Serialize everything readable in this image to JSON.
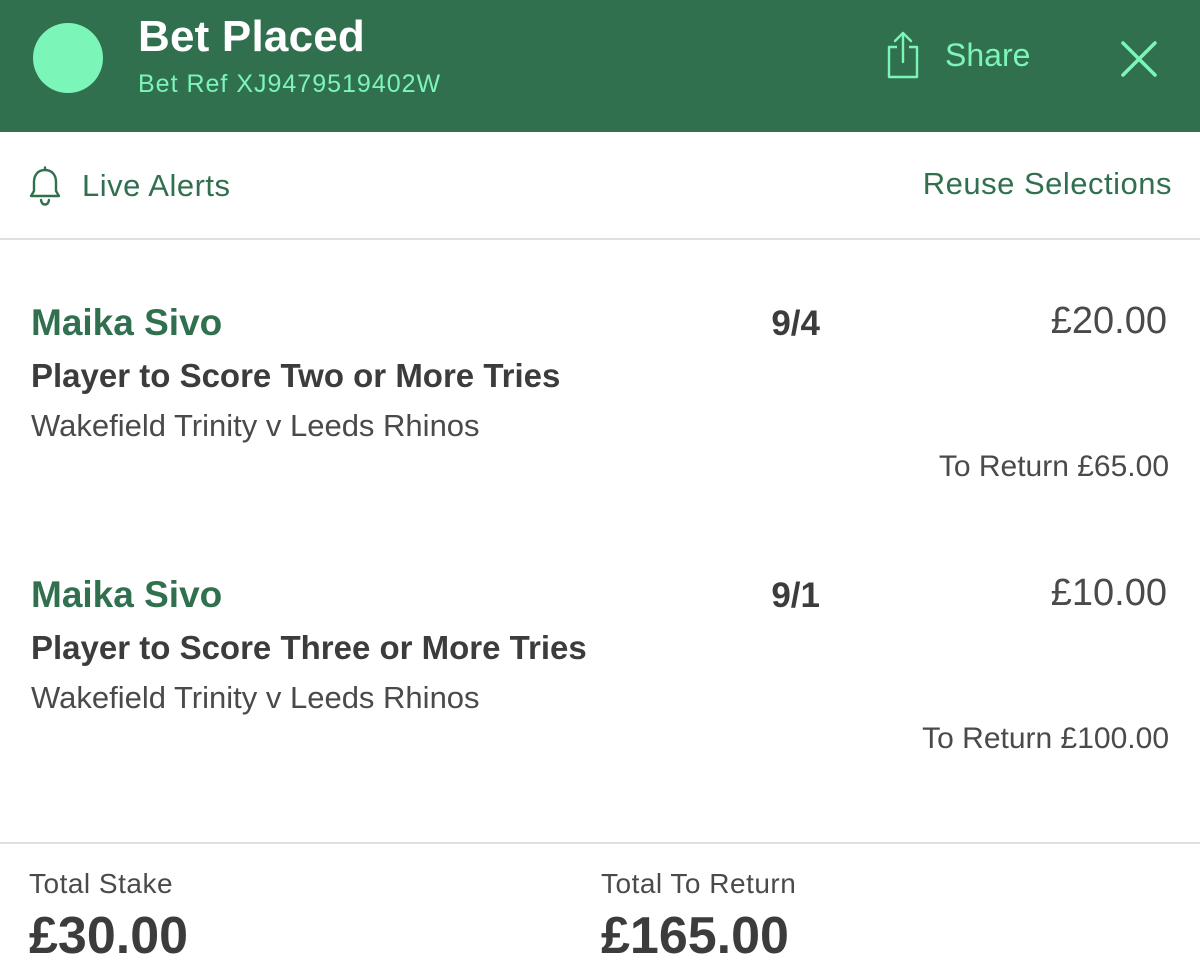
{
  "header": {
    "title": "Bet Placed",
    "bet_ref": "Bet Ref XJ9479519402W",
    "share_label": "Share",
    "share_icon": "share-icon",
    "close_icon": "close-icon",
    "status_color": "#7cf5b8",
    "background_color": "#31704f"
  },
  "toolbar": {
    "live_alerts_label": "Live Alerts",
    "live_alerts_icon": "bell-icon",
    "reuse_label": "Reuse Selections"
  },
  "bets": [
    {
      "selection": "Maika Sivo",
      "market": "Player to Score Two or More Tries",
      "event": "Wakefield Trinity v Leeds Rhinos",
      "odds": "9/4",
      "stake": "£20.00",
      "to_return": "To Return £65.00"
    },
    {
      "selection": "Maika Sivo",
      "market": "Player to Score Three or More Tries",
      "event": "Wakefield Trinity v Leeds Rhinos",
      "odds": "9/1",
      "stake": "£10.00",
      "to_return": "To Return £100.00"
    }
  ],
  "footer": {
    "total_stake_label": "Total Stake",
    "total_stake_value": "£30.00",
    "total_return_label": "Total To Return",
    "total_return_value": "£165.00"
  }
}
